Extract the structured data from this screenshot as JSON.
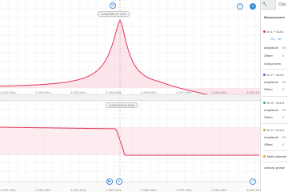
{
  "top_plot": {
    "marker_label": "4.095046100 MHz",
    "x_ticks": [
      "4.092 MHz",
      "4.093 MHz",
      "4.094 MHz",
      "4.095 MHz",
      "4.096 MHz",
      "4.097 MHz",
      "4.098 MHz",
      "4.099 MHz"
    ],
    "buttons": {
      "left": "⊝",
      "right": "+"
    }
  },
  "bottom_plot": {
    "marker_label": "4.095046100 MHz",
    "x_ticks": [
      "4.092 MHz",
      "4.093 MHz",
      "4.094 MHz",
      "4.095 MHz",
      "4.096 MHz",
      "4.097 MHz",
      "4.098 MHz",
      "4.099 MHz"
    ]
  },
  "bottom_bar": {
    "play_label": "▶",
    "pause_label": "⏸",
    "corner_label": "↗"
  },
  "colors": {
    "trace": "#e0365a",
    "fill": "#fbe0e6",
    "grid": "#ececec",
    "accent": "#4a90d9"
  },
  "sidebar": {
    "tabs": [
      "🔧",
      "Cha"
    ],
    "section_title": "Measurement",
    "channels": [
      {
        "name": "In 1 + Out 1",
        "color": "#e0365a"
      },
      {
        "name": "In 2 + Out 2",
        "color": "#5a5ad0"
      },
      {
        "name": "In 3 + Out 3",
        "color": "#2aa88a"
      },
      {
        "name": "In 4 + Out 4",
        "color": "#d4a020"
      }
    ],
    "rows": {
      "dc": "DC · 50",
      "amplitude": "Amplitude",
      "amplitude_val": "50",
      "offset": "Offset",
      "offset_val": "0",
      "output_term": "Output term",
      "math": "Math channel",
      "unwrap": "Unwrap phase"
    }
  }
}
